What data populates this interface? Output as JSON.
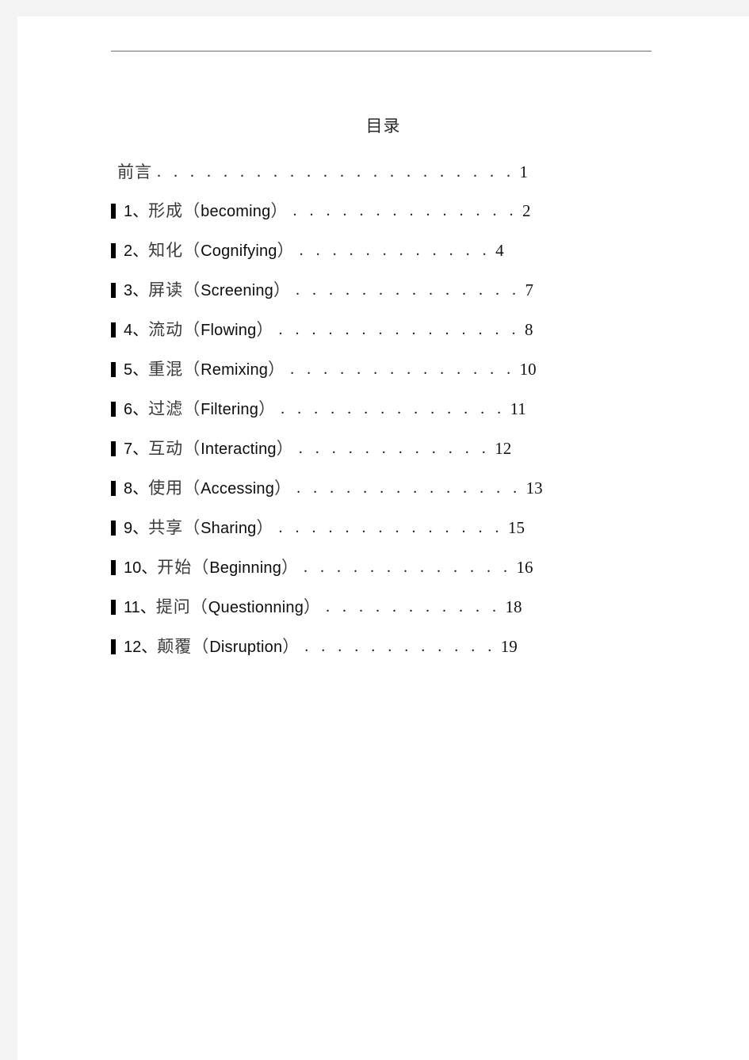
{
  "document": {
    "title": "目录",
    "page_background": "#ffffff",
    "canvas_background": "#f4f4f4",
    "rule_color": "#6e6e6e"
  },
  "toc": {
    "preface": {
      "label": "前言",
      "leader": ". . . . . . . . . . . . . . . . . . . . . .",
      "page": "1"
    },
    "entries": [
      {
        "bullet": "square-bullet-icon",
        "number": "1、",
        "chinese": "形成",
        "open_paren": "（",
        "english": "becoming",
        "close_paren": "）",
        "leader": ". . . . . . . . . . . . . .",
        "page": "2"
      },
      {
        "bullet": "square-bullet-icon",
        "number": "2、",
        "chinese": "知化",
        "open_paren": "（",
        "english": "Cognifying",
        "close_paren": "）",
        "leader": ". . . . . . . . . . . .",
        "page": "4"
      },
      {
        "bullet": "square-bullet-icon",
        "number": "3、",
        "chinese": "屏读",
        "open_paren": "（",
        "english": "Screening",
        "close_paren": "）",
        "leader": ". . . . . . . . . . . . . .",
        "page": "7"
      },
      {
        "bullet": "square-bullet-icon",
        "number": "4、",
        "chinese": "流动",
        "open_paren": "（",
        "english": "Flowing",
        "close_paren": "）",
        "leader": ". . . . . . . . . . . . . . .",
        "page": "8"
      },
      {
        "bullet": "square-bullet-icon",
        "number": "5、",
        "chinese": "重混",
        "open_paren": "（",
        "english": "Remixing",
        "close_paren": "）",
        "leader": ". . . . . . . . . . . . . .",
        "page": "10"
      },
      {
        "bullet": "square-bullet-icon",
        "number": "6、",
        "chinese": "过滤",
        "open_paren": "（",
        "english": "Filtering",
        "close_paren": "）",
        "leader": ". . . . . . . . . . . . . .",
        "page": "11"
      },
      {
        "bullet": "square-bullet-icon",
        "number": "7、",
        "chinese": "互动",
        "open_paren": "（",
        "english": "Interacting",
        "close_paren": "）",
        "leader": ". . . . . . . . . . . .",
        "page": "12"
      },
      {
        "bullet": "square-bullet-icon",
        "number": "8、",
        "chinese": "使用",
        "open_paren": "（",
        "english": "Accessing",
        "close_paren": "）",
        "leader": ". . . . . . . . . . . . . .",
        "page": "13"
      },
      {
        "bullet": "square-bullet-icon",
        "number": "9、",
        "chinese": "共享",
        "open_paren": "（",
        "english": "Sharing",
        "close_paren": "）",
        "leader": ". . . . . . . . . . . . . .",
        "page": "15"
      },
      {
        "bullet": "square-bullet-icon",
        "number": "10、",
        "chinese": "开始",
        "open_paren": "（",
        "english": "Beginning",
        "close_paren": "）",
        "leader": ". . . . . . . . . . . . .",
        "page": "16"
      },
      {
        "bullet": "square-bullet-icon",
        "number": "11、",
        "chinese": "提问",
        "open_paren": "（",
        "english": "Questionning",
        "close_paren": "）",
        "leader": ". . . . . . . . . . .",
        "page": "18"
      },
      {
        "bullet": "square-bullet-icon",
        "number": "12、",
        "chinese": "颠覆",
        "open_paren": "（",
        "english": "Disruption",
        "close_paren": "）",
        "leader": ". . . . . . . . . . . .",
        "page": "19"
      }
    ]
  }
}
